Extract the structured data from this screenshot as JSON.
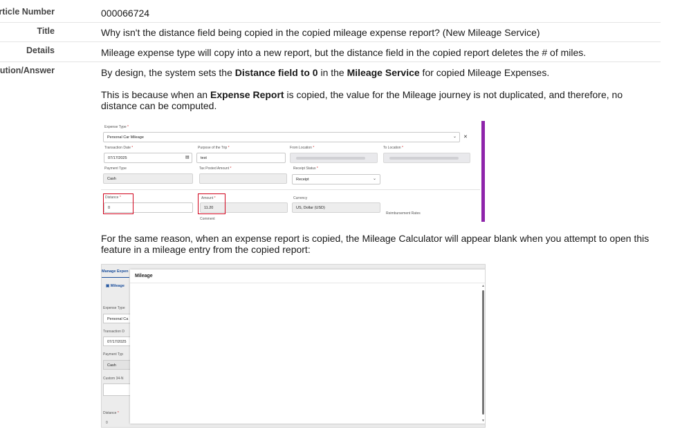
{
  "article": {
    "number_label": "Article Number",
    "number_value": "000066724",
    "title_label": "Title",
    "title_value": "Why isn't the distance field being copied in the copied mileage expense report? (New Mileage Service)",
    "details_label": "Details",
    "details_value": "Mileage expense type will copy into a new report, but the distance field in the copied report deletes the # of miles.",
    "resolution_label": "Resolution/Answer",
    "resolution_p1": {
      "t1": "By design, the system sets the ",
      "b1": "Distance field to 0",
      "t2": " in the ",
      "b2": "Mileage Service",
      "t3": " for copied Mileage Expenses."
    },
    "resolution_p2": {
      "t1": "This is because when an ",
      "b1": "Expense Report",
      "t2": " is copied, the value for the Mileage journey is not duplicated, and therefore, no distance can be computed."
    },
    "resolution_p3": "For the same reason, when an expense report is copied, the Mileage Calculator will appear blank when you attempt to open this feature in a mileage entry from the copied report:"
  },
  "screenshot1": {
    "expense_type_label": "Expense Type",
    "expense_type_value": "Personal Car Mileage",
    "transaction_date_label": "Transaction Date",
    "transaction_date_value": "07/17/2025",
    "purpose_label": "Purpose of the Trip",
    "purpose_value": "test",
    "from_location_label": "From Location",
    "to_location_label": "To Location",
    "payment_type_label": "Payment Type",
    "payment_type_value": "Cash",
    "tax_posted_label": "Tax Posted Amount",
    "receipt_status_label": "Receipt Status",
    "receipt_status_value": "Receipt",
    "distance_label": "Distance",
    "distance_value": "0",
    "amount_label": "Amount",
    "amount_value": "11.20",
    "comment_label": "Comment",
    "currency_label": "Currency",
    "currency_value": "US, Dollar (USD)",
    "reimbursement_rates_label": "Reimbursement Rates",
    "required_mark": "*",
    "highlight_color": "#d0021b",
    "accent_color": "#8e24aa"
  },
  "screenshot2": {
    "tab_label": "Manage Expen",
    "mileage_link": "Mileage",
    "expense_type_label": "Expense Type",
    "expense_type_value": "Personal Ca",
    "transaction_date_label": "Transaction D",
    "transaction_date_value": "07/17/2025",
    "payment_type_label": "Payment Typ",
    "payment_type_value": "Cash",
    "custom_label": "Custom 34-N",
    "distance_label": "Distance",
    "distance_value": "0",
    "required_mark": "*",
    "modal_title": "Mileage"
  }
}
